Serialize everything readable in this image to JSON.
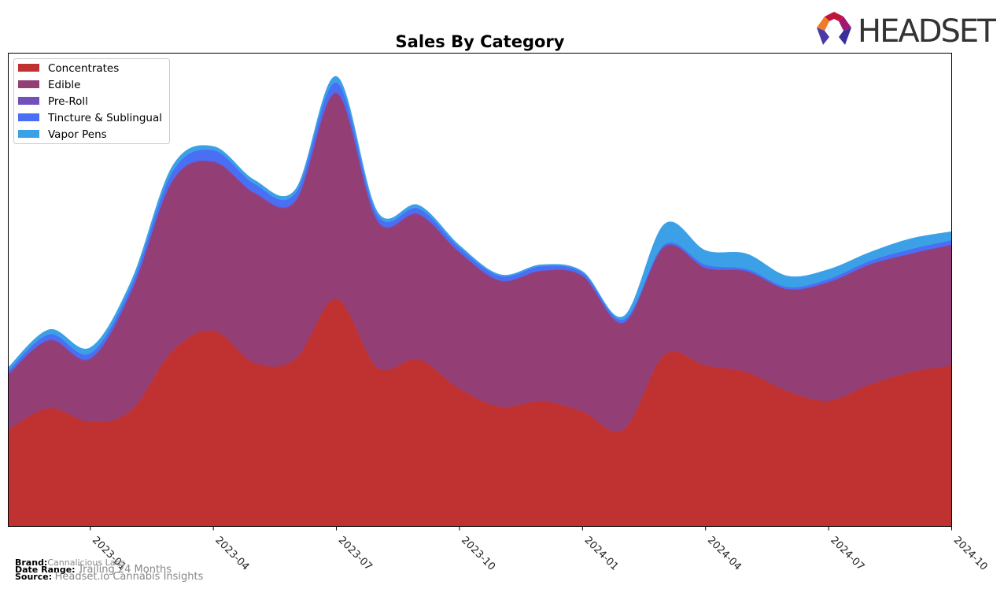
{
  "brand_logo": {
    "text": "HEADSET"
  },
  "footer": {
    "brand_label": "Brand:",
    "brand_value": "Cannalicious Labs",
    "date_range_label": "Date Range:",
    "date_range_value": "Trailing 24 Months",
    "source_label": "Source:",
    "source_value": "Headset.io Cannabis Insights"
  },
  "chart_data": {
    "type": "area",
    "stacked": true,
    "smoothed": true,
    "title": "Sales By Category",
    "xlabel": "",
    "ylabel": "",
    "y_axis_visible": false,
    "ylim": [
      0,
      100
    ],
    "y_units": "relative (share of plot height, no y-axis shown)",
    "grid": false,
    "legend_position": "top-left",
    "x": [
      "2022-11",
      "2022-12",
      "2023-01",
      "2023-02",
      "2023-03",
      "2023-04",
      "2023-05",
      "2023-06",
      "2023-07",
      "2023-08",
      "2023-09",
      "2023-10",
      "2023-11",
      "2023-12",
      "2024-01",
      "2024-02",
      "2024-03",
      "2024-04",
      "2024-05",
      "2024-06",
      "2024-07",
      "2024-08",
      "2024-09",
      "2024-10"
    ],
    "x_ticks": [
      "2023-01",
      "2023-04",
      "2023-07",
      "2023-10",
      "2024-01",
      "2024-04",
      "2024-07",
      "2024-10"
    ],
    "series": [
      {
        "name": "Concentrates",
        "color": "#c03232",
        "values": [
          20.5,
          25.0,
          22.1,
          24.6,
          37.1,
          41.4,
          34.6,
          35.4,
          48.1,
          33.6,
          35.3,
          29.1,
          25.3,
          26.5,
          24.3,
          20.5,
          36.3,
          34.0,
          32.6,
          28.6,
          26.6,
          30.0,
          32.6,
          34.0
        ]
      },
      {
        "name": "Edible",
        "color": "#933f76",
        "values": [
          11.6,
          14.3,
          13.3,
          25.0,
          35.8,
          35.6,
          35.8,
          33.3,
          43.4,
          30.9,
          30.6,
          28.8,
          26.6,
          27.5,
          28.6,
          22.5,
          22.8,
          20.6,
          21.3,
          21.5,
          25.0,
          25.3,
          25.0,
          25.5
        ]
      },
      {
        "name": "Pre-Roll",
        "color": "#7150bc",
        "values": [
          0.2,
          0.2,
          0.2,
          0.2,
          0.2,
          0.2,
          0.2,
          0.2,
          0.2,
          0.2,
          0.2,
          0.1,
          0.1,
          0.1,
          0.1,
          0.1,
          0.1,
          0.1,
          0.1,
          0.1,
          0.1,
          0.1,
          0.1,
          0.1
        ]
      },
      {
        "name": "Tincture & Sublingual",
        "color": "#4a6ff5",
        "values": [
          0.6,
          1.1,
          1.0,
          1.1,
          1.8,
          2.3,
          1.8,
          1.5,
          2.1,
          1.1,
          1.1,
          0.9,
          0.9,
          0.9,
          0.6,
          0.6,
          0.4,
          0.6,
          0.4,
          0.4,
          0.6,
          0.7,
          0.9,
          0.9
        ]
      },
      {
        "name": "Vapor Pens",
        "color": "#3ca0e6",
        "values": [
          0.7,
          1.0,
          1.2,
          1.0,
          1.2,
          0.8,
          0.8,
          0.8,
          1.3,
          0.7,
          0.7,
          0.5,
          0.3,
          0.3,
          0.3,
          0.7,
          4.3,
          3.0,
          3.2,
          2.3,
          2.0,
          1.8,
          2.2,
          1.8
        ]
      }
    ]
  }
}
